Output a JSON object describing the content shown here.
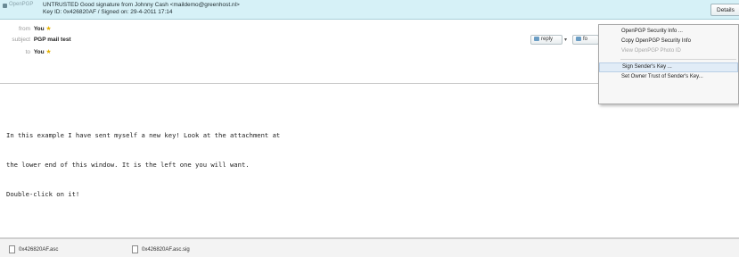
{
  "pgp": {
    "label": "OpenPGP",
    "status_line1": "UNTRUSTED Good signature from Johnny Cash <maildemo@greenhost.nl>",
    "status_line2": "Key ID: 0x426820AF / Signed on: 29-4-2011 17:14",
    "details_label": "Details"
  },
  "header": {
    "from_label": "from",
    "from_value": "You",
    "subject_label": "subject",
    "subject_value": "PGP mail test",
    "to_label": "to",
    "to_value": "You",
    "reply_label": "reply",
    "dropdown_glyph": "▾",
    "forward_label": "fo"
  },
  "menu": {
    "items": [
      {
        "label": "OpenPGP Security Info ...",
        "state": "normal"
      },
      {
        "label": "Copy OpenPGP Security Info",
        "state": "normal"
      },
      {
        "label": "View OpenPGP Photo ID",
        "state": "disabled"
      },
      {
        "label": "Sign Sender's Key ...",
        "state": "hover"
      },
      {
        "label": "Set Owner Trust of Sender's Key...",
        "state": "normal"
      }
    ]
  },
  "body": {
    "lines": [
      "In this example I have sent myself a new key! Look at the attachment at",
      "the lower end of this window. It is the left one you will want.",
      "Double-click on it!"
    ]
  },
  "attachments": [
    {
      "name": "0x426820AF.asc"
    },
    {
      "name": "0x426820AF.asc.sig"
    }
  ],
  "icons": {
    "star": "★"
  }
}
